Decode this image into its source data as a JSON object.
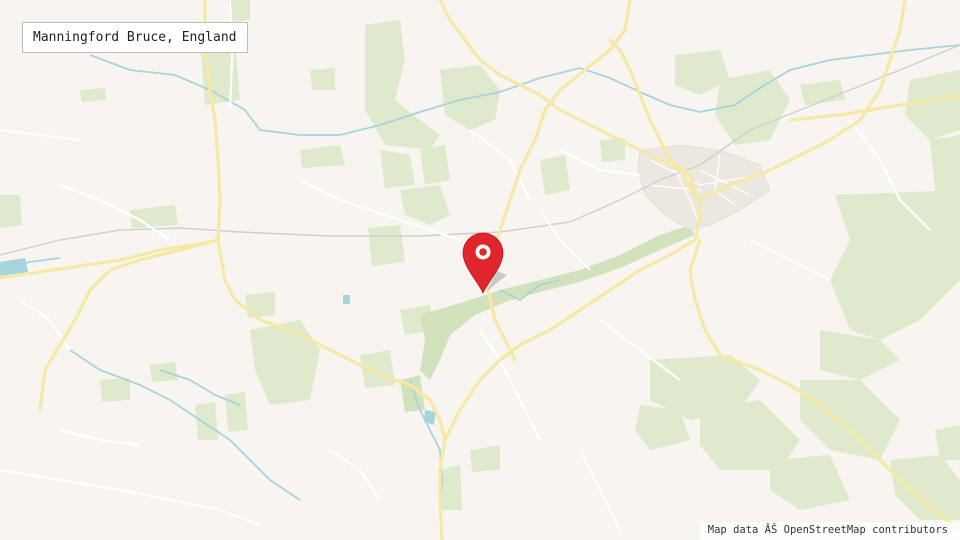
{
  "map": {
    "place_name": "Manningford Bruce, England",
    "attribution": "Map data ÂŠ OpenStreetMap contributors",
    "marker_icon": "map-pin-icon",
    "colors": {
      "background": "#f8f5f0",
      "woodland": "#dfe9cc",
      "woodland_dark": "#d2e2bc",
      "road_major": "#f6e9a6",
      "road_minor": "#ffffff",
      "river": "#a8d4dc",
      "railway": "#cfcfcf",
      "marker": "#e1252c"
    }
  }
}
